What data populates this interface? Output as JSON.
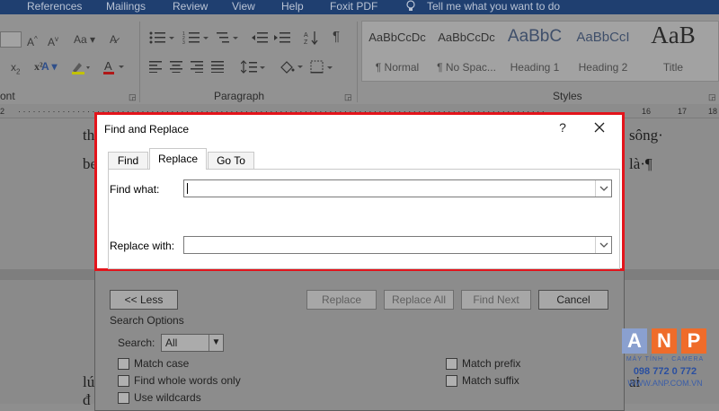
{
  "menubar": {
    "items": [
      "References",
      "Mailings",
      "Review",
      "View",
      "Help",
      "Foxit PDF",
      "Tell me what you want to do"
    ]
  },
  "ribbon": {
    "groups": {
      "font": "ont",
      "paragraph": "Paragraph",
      "styles": "Styles"
    },
    "styles": [
      {
        "sample": "AaBbCcDc",
        "name": "¶ Normal"
      },
      {
        "sample": "AaBbCcDc",
        "name": "¶ No Spac..."
      },
      {
        "sample": "AaBbC",
        "name": "Heading 1"
      },
      {
        "sample": "AaBbCcI",
        "name": "Heading 2"
      },
      {
        "sample": "AaB",
        "name": "Title"
      }
    ]
  },
  "ruler": {
    "marks": [
      "2",
      "1",
      "16",
      "17",
      "18"
    ]
  },
  "document": {
    "line1_left": "th",
    "line1_right": "sông·",
    "line2_left": "be",
    "line2_right": "là·¶",
    "line3_left": "lú",
    "line3_right": "ai",
    "line4_left": "đ"
  },
  "dialog": {
    "title": "Find and Replace",
    "help_label": "?",
    "tabs": {
      "find": "Find",
      "replace": "Replace",
      "goto": "Go To"
    },
    "find_what_label": "Find what:",
    "find_what_value": "",
    "replace_with_label": "Replace with:",
    "replace_with_value": "",
    "buttons": {
      "less": "<< Less",
      "replace": "Replace",
      "replace_all": "Replace All",
      "find_next": "Find Next",
      "cancel": "Cancel"
    },
    "search_options_label": "Search Options",
    "search_label": "Search:",
    "search_value": "All",
    "options": {
      "match_case": "Match case",
      "whole_words": "Find whole words only",
      "wildcards": "Use wildcards",
      "match_prefix": "Match prefix",
      "match_suffix": "Match suffix"
    }
  },
  "watermark": {
    "letters": [
      "A",
      "N",
      "P"
    ],
    "tagline": "MÁY TÍNH · CAMERA",
    "phone": "098 772 0 772",
    "website": "WWW.ANP.COM.VN"
  },
  "colors": {
    "highlight_border": "#e3141b",
    "anp_orange": "#ef6c2a",
    "anp_blue": "#2a4fa0"
  }
}
